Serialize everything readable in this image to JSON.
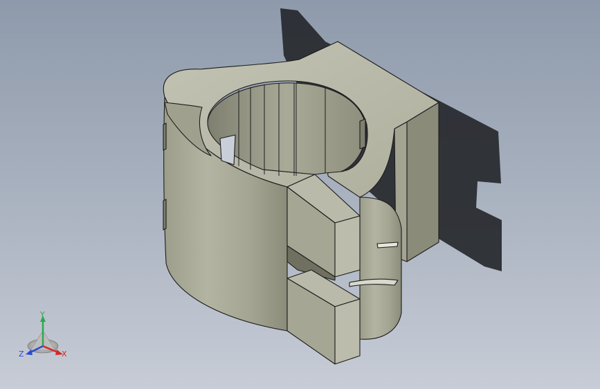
{
  "viewport": {
    "background_top": "#8e9aab",
    "background_bottom": "#c7ccd6",
    "model": {
      "name": "pipe-clamp",
      "face_light": "#b8b9a8",
      "face_mid": "#a6a795",
      "face_dark": "#8d8e7c",
      "edge": "#1a1a1a",
      "shadow": "#2a2c30"
    },
    "triad": {
      "x_label": "X",
      "y_label": "Y",
      "z_label": "Z",
      "x_color": "#d62828",
      "y_color": "#2fa84f",
      "z_color": "#2a4bd0"
    }
  }
}
